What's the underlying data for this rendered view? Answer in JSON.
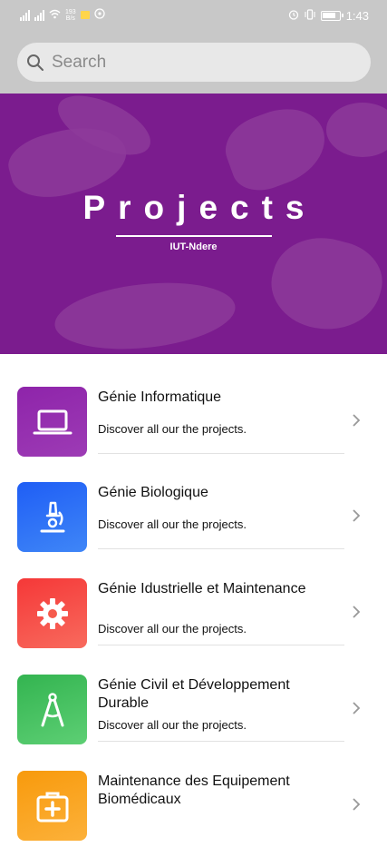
{
  "status_bar": {
    "network_speed": "193\nB/s",
    "time": "1:43"
  },
  "search": {
    "placeholder": "Search",
    "value": ""
  },
  "banner": {
    "title": "Projects",
    "subtitle": "IUT-Ndere"
  },
  "projects": [
    {
      "title": "Génie Informatique",
      "description": "Discover all our the projects.",
      "icon": "laptop-icon",
      "color": "#8e24aa"
    },
    {
      "title": "Génie Biologique",
      "description": "Discover all our the projects.",
      "icon": "microscope-icon",
      "color": "#2f6df6"
    },
    {
      "title": "Génie Idustrielle et Maintenance",
      "description": "Discover all our the projects.",
      "icon": "gear-icon",
      "color": "#f4433a"
    },
    {
      "title": "Génie Civil et Développement Durable",
      "description": "Discover all our the projects.",
      "icon": "compass-icon",
      "color": "#3ec05b"
    },
    {
      "title": "Maintenance des Equipement Biomédicaux",
      "description": "",
      "icon": "medical-kit-icon",
      "color": "#fba314"
    }
  ]
}
